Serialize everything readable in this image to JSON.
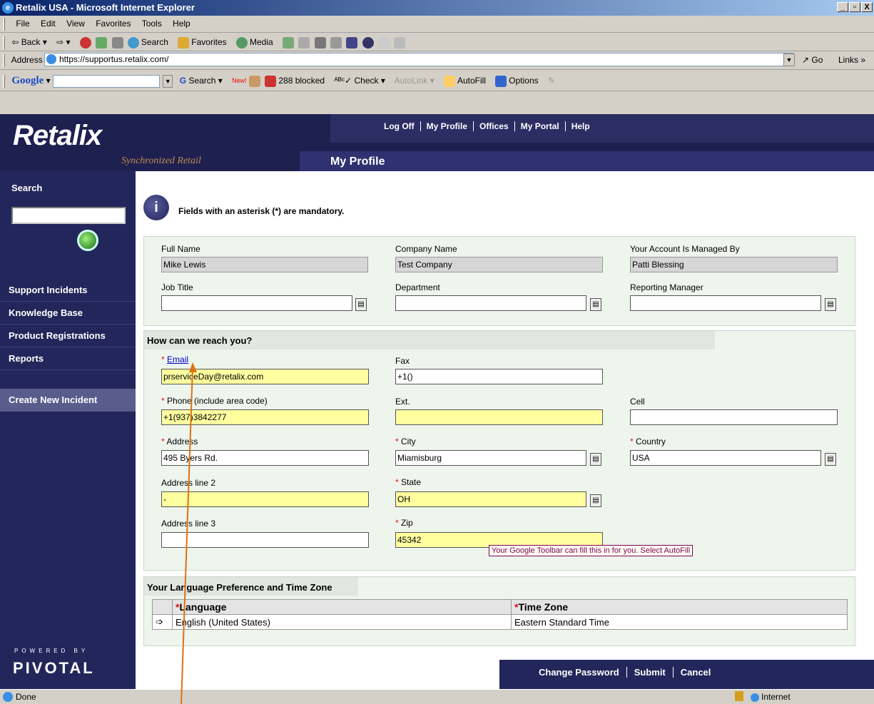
{
  "window": {
    "title": "Retalix USA - Microsoft Internet Explorer",
    "min": "_",
    "max": "▫",
    "close": "X"
  },
  "menu": [
    "File",
    "Edit",
    "View",
    "Favorites",
    "Tools",
    "Help"
  ],
  "toolbar": {
    "back": "Back",
    "search": "Search",
    "favorites": "Favorites",
    "media": "Media"
  },
  "address": {
    "label": "Address",
    "url": "https://supportus.retalix.com/",
    "go": "Go",
    "links": "Links"
  },
  "googlebar": {
    "logo": "Google",
    "search": "Search",
    "new_badge": "New!",
    "blocked": "288 blocked",
    "check": "Check",
    "autolink": "AutoLink",
    "autofill": "AutoFill",
    "options": "Options"
  },
  "header": {
    "logo": "Retalix",
    "tagline": "Synchronized Retail",
    "page_title": "My Profile",
    "nav": [
      "Log Off",
      "My Profile",
      "Offices",
      "My Portal",
      "Help"
    ]
  },
  "sidebar": {
    "search_label": "Search",
    "items": [
      "Support Incidents",
      "Knowledge Base",
      "Product Registrations",
      "Reports"
    ],
    "create": "Create New Incident",
    "powered": "POWERED BY",
    "pivotal": "PIVOTAL"
  },
  "notice": "Fields with an asterisk (*) are mandatory.",
  "profile": {
    "full_name_label": "Full Name",
    "full_name": "Mike Lewis",
    "company_label": "Company Name",
    "company": "Test Company",
    "manager_label": "Your Account Is Managed By",
    "manager": "Patti Blessing",
    "job_title_label": "Job Title",
    "job_title": "",
    "department_label": "Department",
    "department": "",
    "reporting_label": "Reporting Manager",
    "reporting": ""
  },
  "contact": {
    "heading": "How can we reach you?",
    "email_label": "Email",
    "email": "prserviceDay@retalix.com",
    "fax_label": "Fax",
    "fax": "+1()",
    "phone_label": "Phone (include area code)",
    "phone": "+1(937)3842277",
    "ext_label": "Ext.",
    "ext": "",
    "cell_label": "Cell",
    "cell": "",
    "address_label": "Address",
    "address": "495 Byers Rd.",
    "city_label": "City",
    "city": "Miamisburg",
    "country_label": "Country",
    "country": "USA",
    "address2_label": "Address line 2",
    "address2": "-",
    "state_label": "State",
    "state": "OH",
    "address3_label": "Address line 3",
    "address3": "",
    "zip_label": "Zip",
    "zip": "45342",
    "tooltip": "Your Google Toolbar can fill this in for you. Select AutoFill"
  },
  "language": {
    "heading": "Your Language Preference and Time Zone",
    "col_language": "Language",
    "col_timezone": "Time Zone",
    "row_language": "English (United States)",
    "row_timezone": "Eastern Standard Time"
  },
  "buttons": {
    "change_password": "Change Password",
    "submit": "Submit",
    "cancel": "Cancel"
  },
  "status": {
    "done": "Done",
    "zone": "Internet"
  },
  "colors": {
    "navy": "#23265a",
    "panel": "#eef5ec",
    "required": "#e01010",
    "highlight": "#ffffa0",
    "arrow": "#e07010"
  }
}
